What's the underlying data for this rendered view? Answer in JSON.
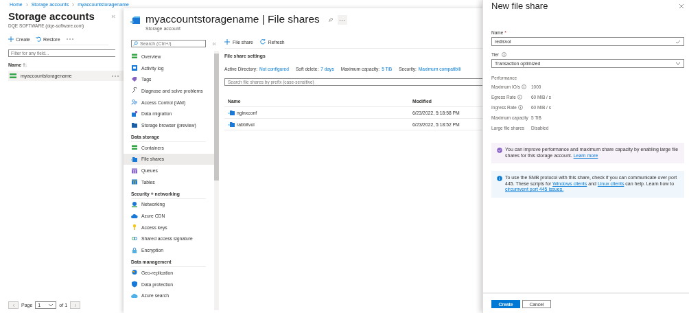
{
  "breadcrumb": [
    "Home",
    "Storage accounts",
    "myaccountstoragename"
  ],
  "accounts": {
    "title": "Storage accounts",
    "subtitle": "DQE SOFTWARE (dqe-software.com)",
    "toolbar": [
      "Create",
      "Restore"
    ],
    "filter_placeholder": "Filter for any field...",
    "column": "Name",
    "rows": [
      {
        "name": "myaccountstoragename",
        "selected": true
      }
    ],
    "pager": {
      "label": "Page",
      "value": "1",
      "of": "of 1"
    }
  },
  "resource": {
    "title": "myaccountstoragename | File shares",
    "subtitle": "Storage account",
    "search_placeholder": "Search (Ctrl+/)",
    "menu": [
      {
        "items": [
          {
            "label": "Overview",
            "selected": false
          },
          {
            "label": "Activity log",
            "selected": false
          },
          {
            "label": "Tags",
            "selected": false
          },
          {
            "label": "Diagnose and solve problems",
            "selected": false
          },
          {
            "label": "Access Control (IAM)",
            "selected": false
          },
          {
            "label": "Data migration",
            "selected": false
          },
          {
            "label": "Storage browser (preview)",
            "selected": false
          }
        ]
      },
      {
        "heading": "Data storage",
        "items": [
          {
            "label": "Containers",
            "selected": false
          },
          {
            "label": "File shares",
            "selected": true
          },
          {
            "label": "Queues",
            "selected": false
          },
          {
            "label": "Tables",
            "selected": false
          }
        ]
      },
      {
        "heading": "Security + networking",
        "items": [
          {
            "label": "Networking",
            "selected": false
          },
          {
            "label": "Azure CDN",
            "selected": false
          },
          {
            "label": "Access keys",
            "selected": false
          },
          {
            "label": "Shared access signature",
            "selected": false
          },
          {
            "label": "Encryption",
            "selected": false
          }
        ]
      },
      {
        "heading": "Data management",
        "items": [
          {
            "label": "Geo-replication",
            "selected": false
          },
          {
            "label": "Data protection",
            "selected": false
          },
          {
            "label": "Azure search",
            "selected": false
          }
        ]
      }
    ]
  },
  "file_shares": {
    "toolbar": [
      "File share",
      "Refresh"
    ],
    "settings_title": "File share settings",
    "settings": [
      {
        "label": "Active Directory:",
        "value": "Not configured"
      },
      {
        "label": "Soft delete:",
        "value": "7 days"
      },
      {
        "label": "Maximum capacity:",
        "value": "5 TiB"
      },
      {
        "label": "Security:",
        "value": "Maximum compatibili"
      }
    ],
    "search_placeholder": "Search file shares by prefix (case-sensitive)",
    "columns": [
      "Name",
      "Modified"
    ],
    "rows": [
      {
        "name": "nginxconf",
        "modified": "6/23/2022, 5:18:58 PM"
      },
      {
        "name": "rabbitvol",
        "modified": "6/23/2022, 5:18:52 PM"
      }
    ]
  },
  "new_file_share": {
    "title": "New file share",
    "name_label": "Name",
    "required": "*",
    "name_value": "redisvol",
    "tier_label": "Tier",
    "tier_value": "Transaction optimized",
    "performance_heading": "Performance",
    "properties": [
      {
        "label": "Maximum IO/s",
        "info": true,
        "value": "1000"
      },
      {
        "label": "Egress Rate",
        "info": true,
        "value": "60 MiB / s"
      },
      {
        "label": "Ingress Rate",
        "info": true,
        "value": "60 MiB / s"
      },
      {
        "label": "Maximum capacity",
        "info": false,
        "value": "5 TiB"
      },
      {
        "label": "Large file shares",
        "info": false,
        "value": "Disabled"
      }
    ],
    "notices": [
      {
        "kind": "upgrade",
        "parts": [
          {
            "text": "You can improve performance and maximum share capacity by enabling large file shares for this storage account. "
          },
          {
            "link": "Learn more"
          }
        ]
      },
      {
        "kind": "info",
        "parts": [
          {
            "text": "To use the SMB protocol with this share, check if you can communicate over port 445. These scripts for "
          },
          {
            "link": "Windows clients"
          },
          {
            "text": " and "
          },
          {
            "link": "Linux clients"
          },
          {
            "text": " can help. Learn how to "
          },
          {
            "link": "circumvent port 445 issues."
          }
        ]
      }
    ],
    "buttons": [
      {
        "label": "Create",
        "primary": true
      },
      {
        "label": "Cancel",
        "primary": false
      }
    ]
  }
}
